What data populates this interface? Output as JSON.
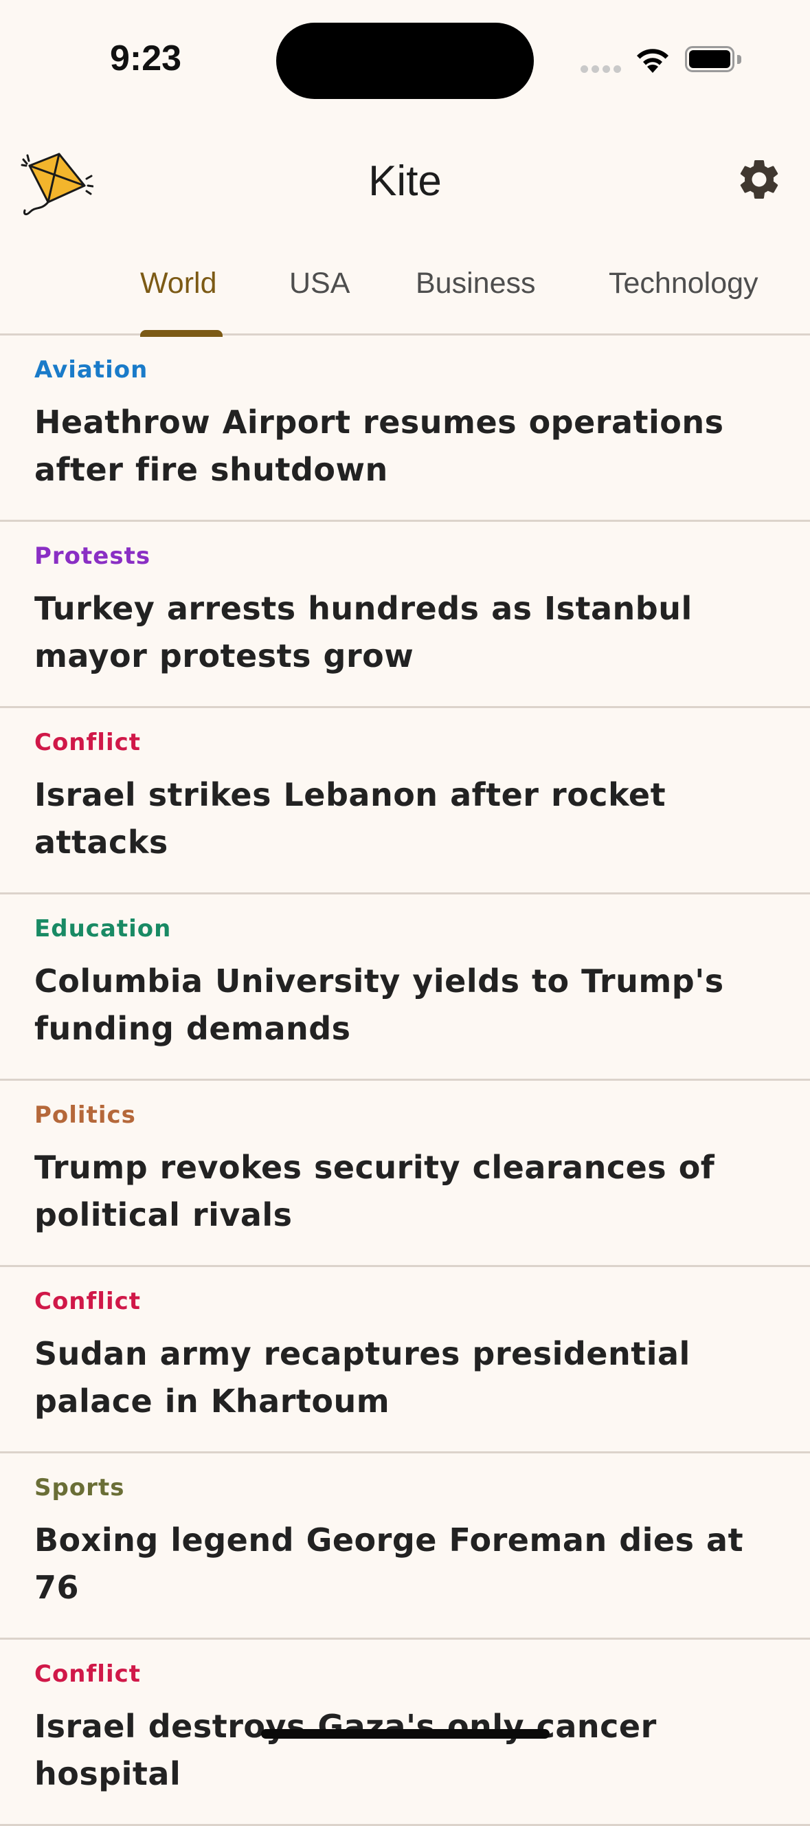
{
  "status_bar": {
    "time": "9:23"
  },
  "header": {
    "title": "Kite",
    "logo_icon": "kite-icon",
    "settings_icon": "gear-icon"
  },
  "tabs": [
    {
      "label": "World",
      "active": true
    },
    {
      "label": "USA",
      "active": false
    },
    {
      "label": "Business",
      "active": false
    },
    {
      "label": "Technology",
      "active": false
    }
  ],
  "colors": {
    "background": "#fdf8f3",
    "accent": "#7c5a15",
    "aviation": "#1a7bc9",
    "protests": "#8a2fc4",
    "conflict": "#d01848",
    "education": "#198a64",
    "politics": "#b5683a",
    "sports": "#6a6e36"
  },
  "stories": [
    {
      "category": "Aviation",
      "color": "#1a7bc9",
      "title": "Heathrow Airport resumes operations after fire shutdown"
    },
    {
      "category": "Protests",
      "color": "#8a2fc4",
      "title": "Turkey arrests hundreds as Istanbul mayor protests grow"
    },
    {
      "category": "Conflict",
      "color": "#d01848",
      "title": "Israel strikes Lebanon after rocket attacks"
    },
    {
      "category": "Education",
      "color": "#198a64",
      "title": "Columbia University yields to Trump's funding demands"
    },
    {
      "category": "Politics",
      "color": "#b5683a",
      "title": "Trump revokes security clearances of political rivals"
    },
    {
      "category": "Conflict",
      "color": "#d01848",
      "title": "Sudan army recaptures presidential palace in Khartoum"
    },
    {
      "category": "Sports",
      "color": "#6a6e36",
      "title": "Boxing legend George Foreman dies at 76"
    },
    {
      "category": "Conflict",
      "color": "#d01848",
      "title": "Israel destroys Gaza's only cancer hospital"
    }
  ]
}
